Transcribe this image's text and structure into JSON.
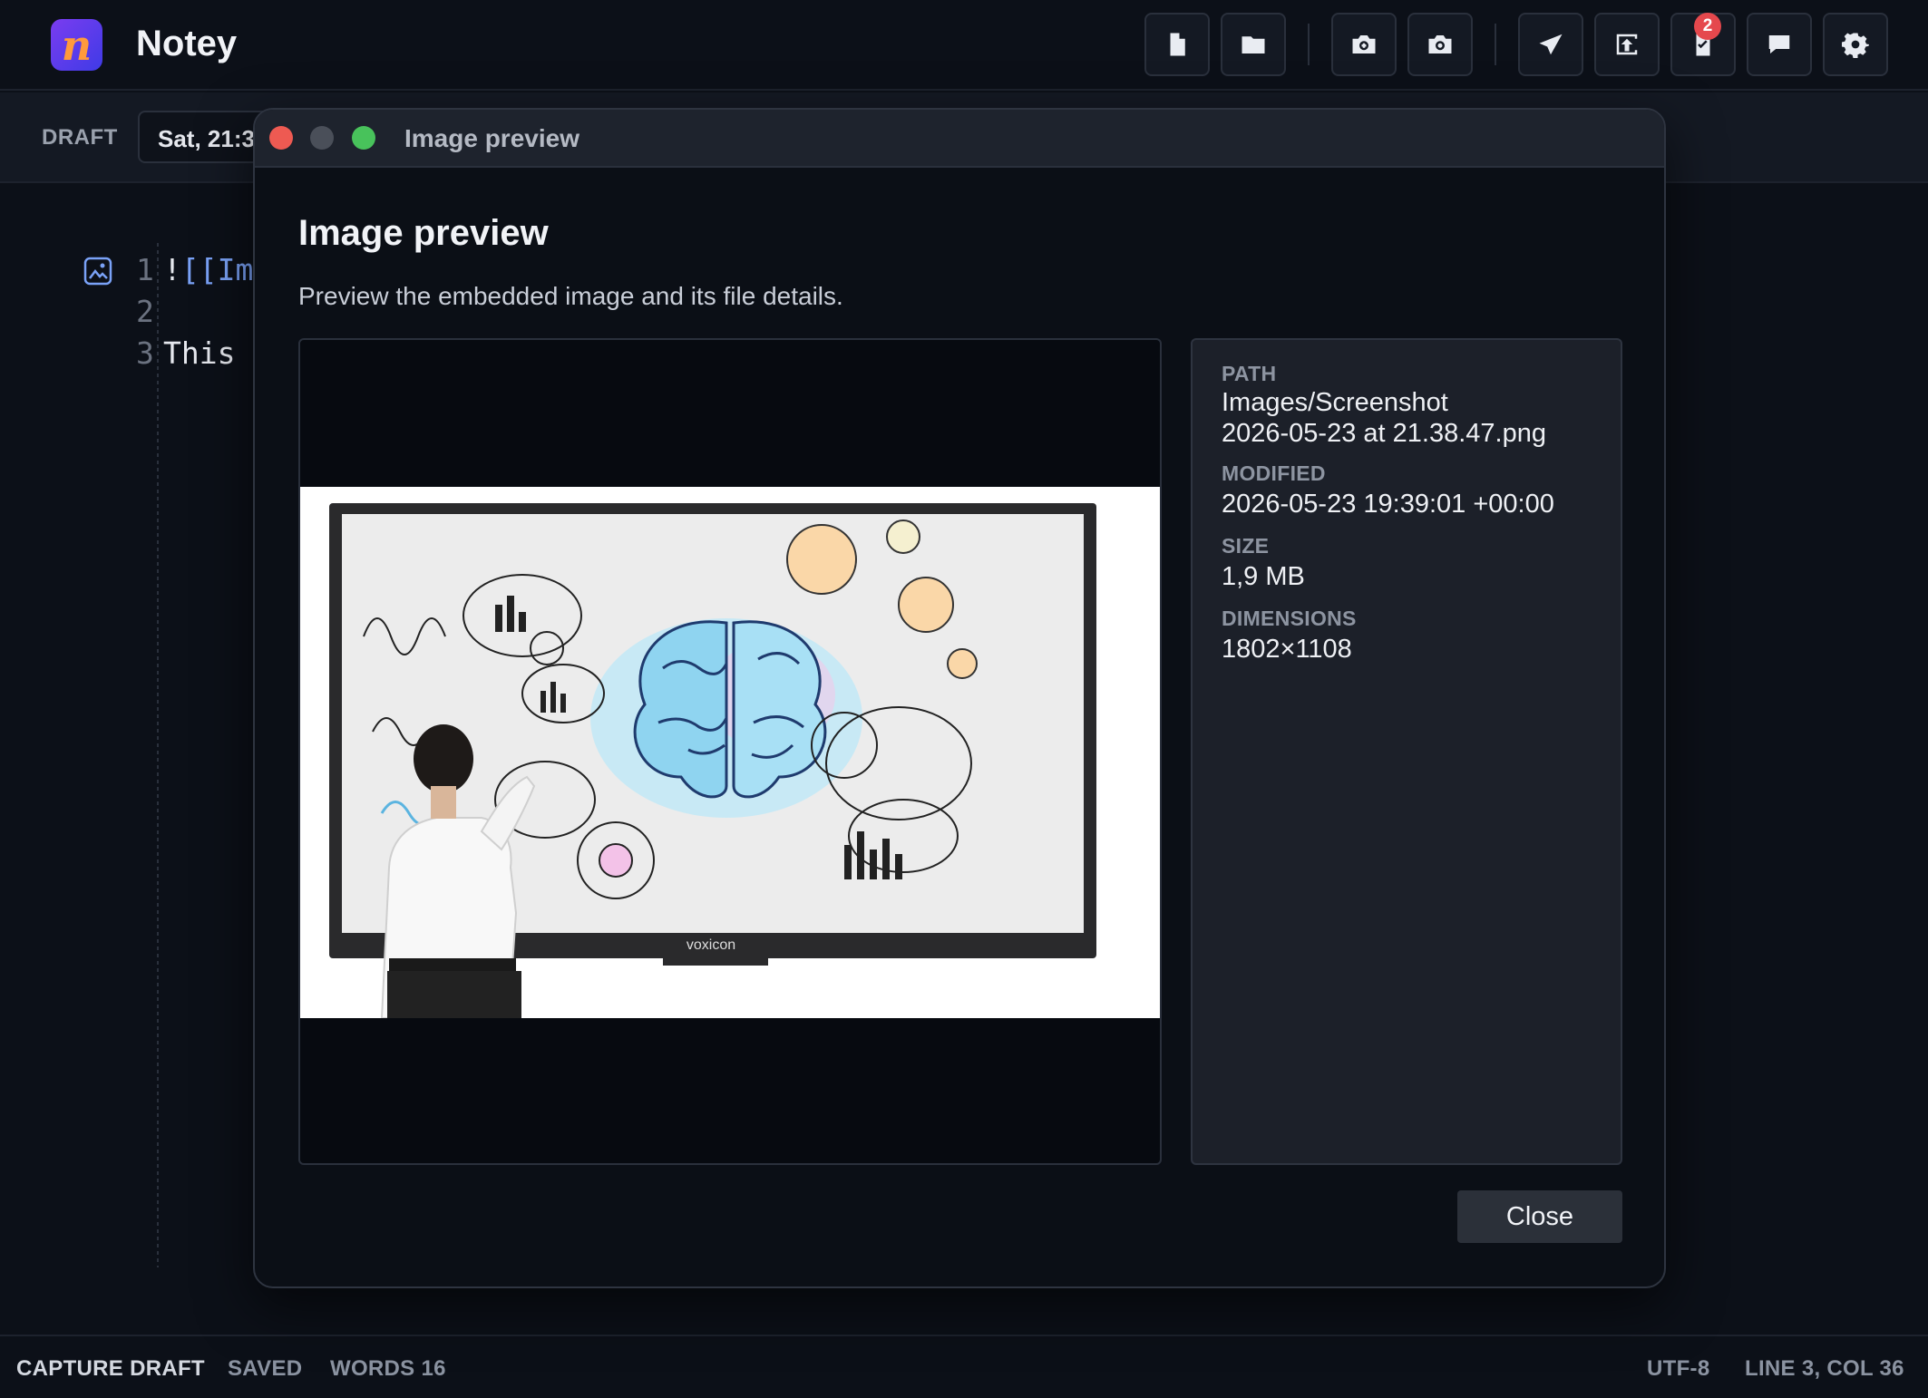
{
  "app": {
    "name": "Notey",
    "logo_letter": "n",
    "logo_colors": {
      "start": "#7a3cf0",
      "end": "#3f3be6",
      "letter": "#ff9a3c"
    }
  },
  "toolbar": {
    "buttons": [
      {
        "icon": "document-icon"
      },
      {
        "icon": "folder-icon"
      },
      {
        "icon": "camera-plus-icon"
      },
      {
        "icon": "camera-icon"
      },
      {
        "icon": "send-icon"
      },
      {
        "icon": "upload-icon"
      },
      {
        "icon": "checklist-icon",
        "badge": "2"
      },
      {
        "icon": "comment-icon"
      },
      {
        "icon": "settings-gear-icon"
      }
    ],
    "badge_color": "#e5484d"
  },
  "draft_bar": {
    "label": "DRAFT",
    "date_value": "Sat, 21:3"
  },
  "editor": {
    "line_numbers": [
      "1",
      "2",
      "3"
    ],
    "lines": {
      "l1_prefix": "!",
      "l1_link": "[[Im",
      "l3": "This"
    },
    "gutter_icon": "image-icon"
  },
  "status_bar": {
    "mode": "CAPTURE DRAFT",
    "saved": "SAVED",
    "words": "WORDS 16",
    "encoding": "UTF-8",
    "position": "LINE 3, COL 36"
  },
  "modal": {
    "window_title": "Image preview",
    "heading": "Image preview",
    "description": "Preview the embedded image and its file details.",
    "details": {
      "path_label": "PATH",
      "path_value_line1": "Images/Screenshot",
      "path_value_line2": "2026-05-23 at 21.38.47.png",
      "modified_label": "MODIFIED",
      "modified_value": "2026-05-23 19:39:01 +00:00",
      "size_label": "SIZE",
      "size_value": "1,9 MB",
      "dimensions_label": "DIMENSIONS",
      "dimensions_value": "1802×1108"
    },
    "preview": {
      "screen_brand": "voxicon"
    },
    "close_label": "Close"
  }
}
